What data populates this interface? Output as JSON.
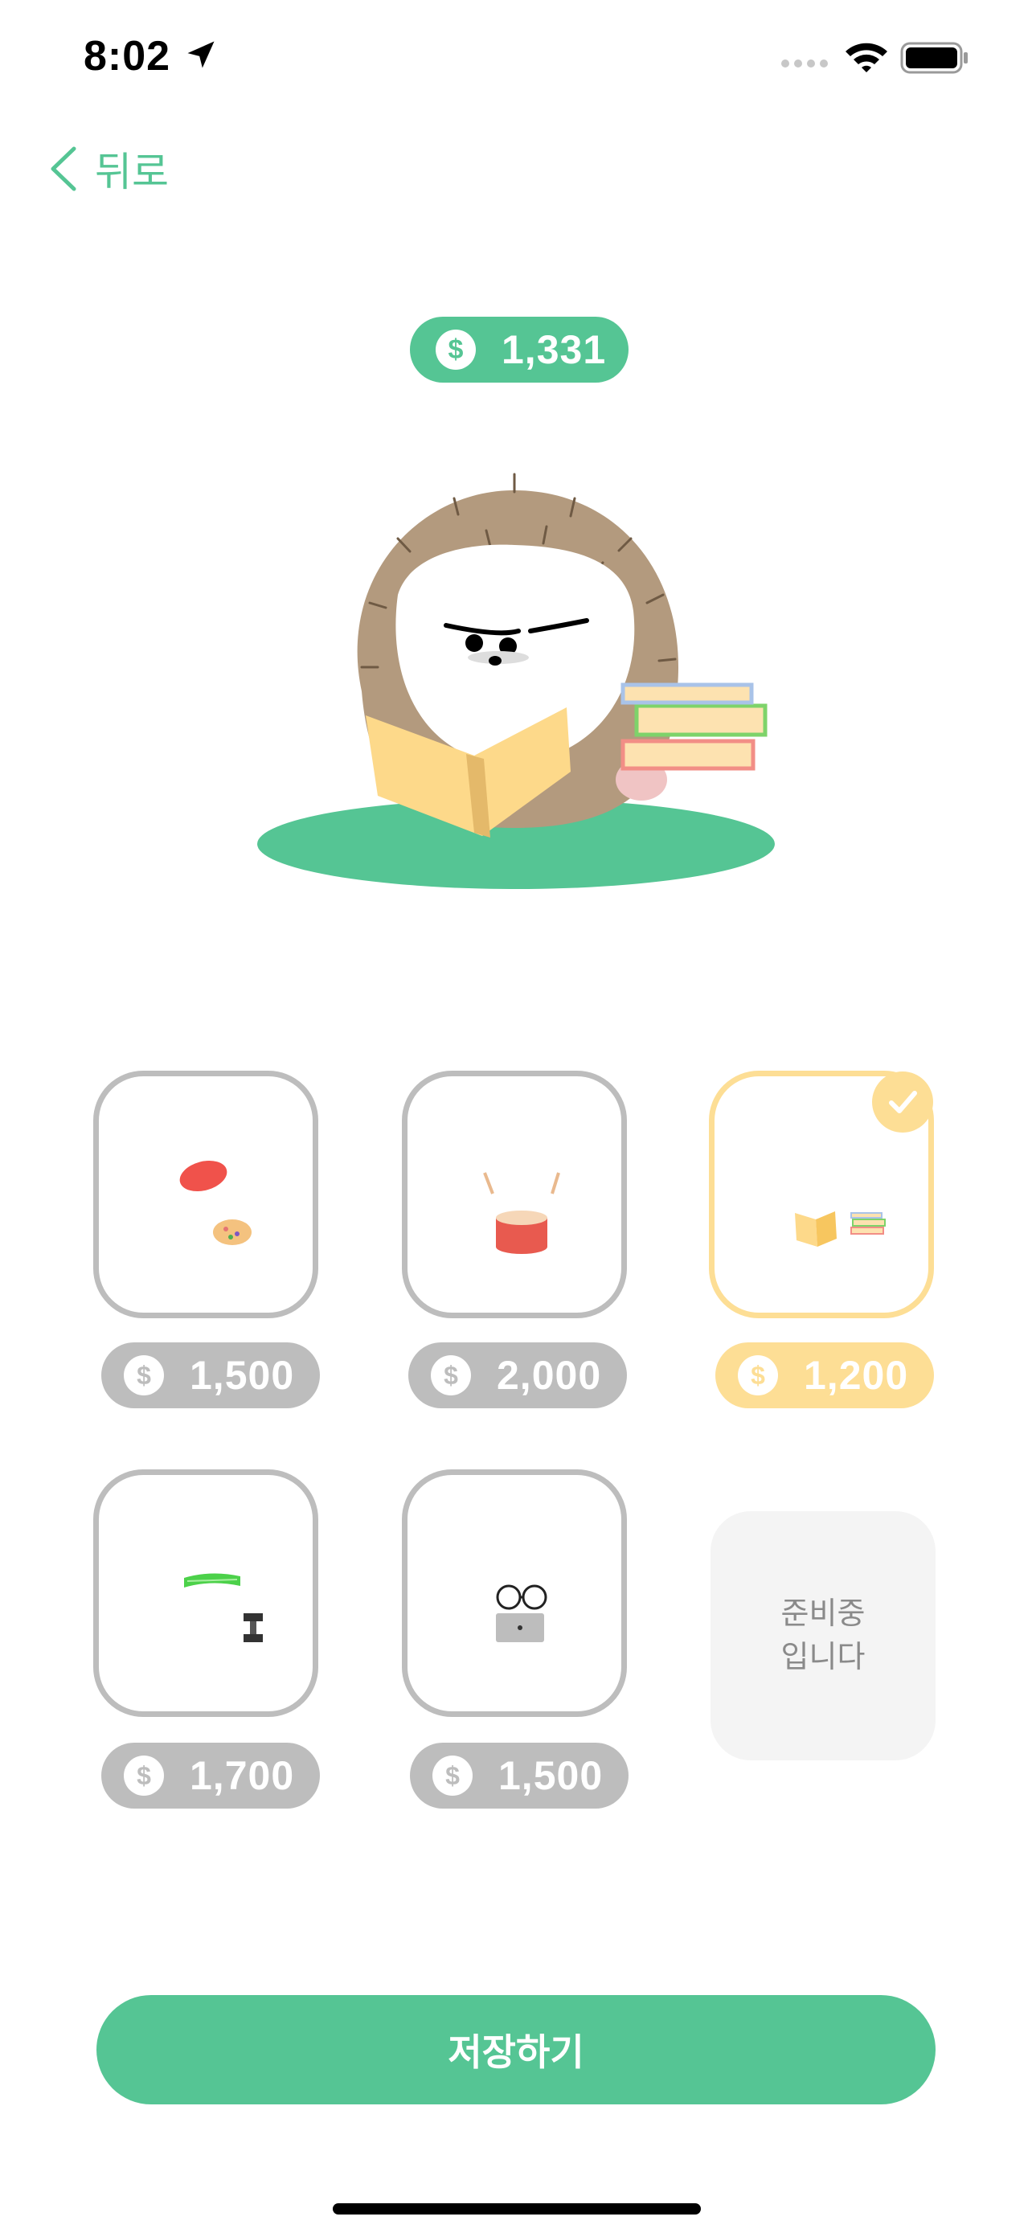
{
  "status_bar": {
    "time": "8:02"
  },
  "nav": {
    "back_label": "뒤로"
  },
  "balance": {
    "coin_symbol": "$",
    "amount": "1,331"
  },
  "items": [
    {
      "name": "frisbee-and-cookie",
      "price": "1,500",
      "selected": false
    },
    {
      "name": "drum",
      "price": "2,000",
      "selected": false
    },
    {
      "name": "books",
      "price": "1,200",
      "selected": true
    },
    {
      "name": "towel-and-dumbbell",
      "price": "1,700",
      "selected": false
    },
    {
      "name": "glasses-and-laptop",
      "price": "1,500",
      "selected": false
    }
  ],
  "coming_soon": {
    "line1": "준비중",
    "line2": "입니다"
  },
  "save_button": {
    "label": "저장하기"
  },
  "colors": {
    "accent": "#55C594",
    "selected": "#FDDE95",
    "inactive": "#BDBDBD",
    "placeholder_bg": "#F4F4F4"
  }
}
